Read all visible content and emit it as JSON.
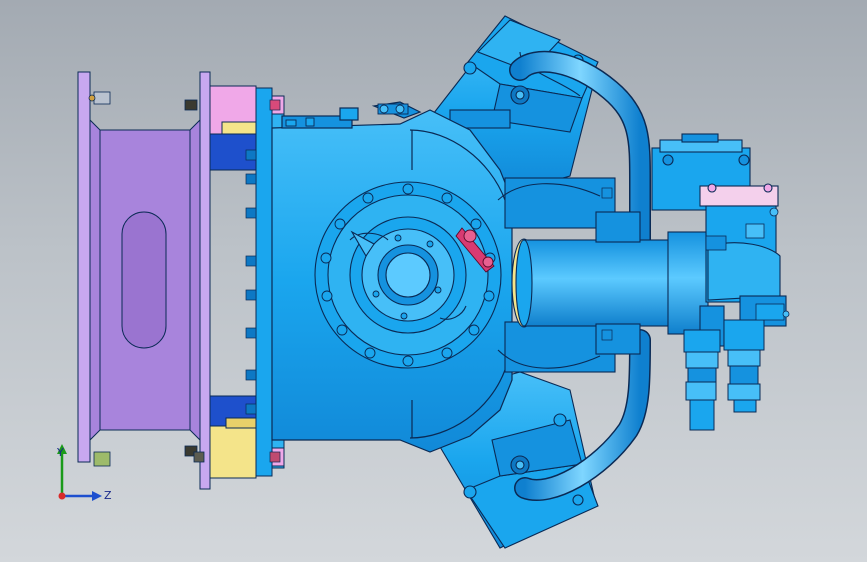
{
  "triad": {
    "y_label": "Y",
    "z_label": "Z"
  },
  "colors": {
    "body": "#1aa6ee",
    "body_light": "#5ccaff",
    "body_dark": "#0d78c4",
    "outline": "#0a2a55",
    "flange_purple": "#a884dc",
    "flange_pink": "#f0a8e8",
    "accent_yellow": "#f4e48a",
    "accent_blue": "#1d4fcf",
    "valve_red": "#d83a72",
    "bracket_pink": "#f4d0ec"
  }
}
